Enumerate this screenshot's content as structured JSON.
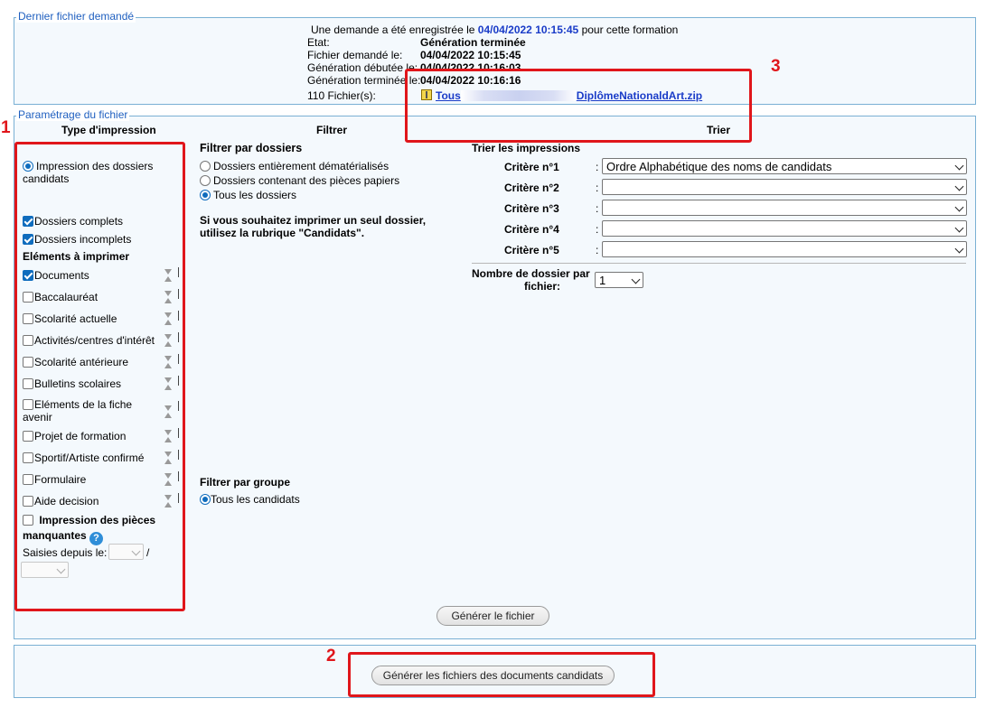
{
  "section_last_file": {
    "legend": "Dernier fichier demandé",
    "intro_prefix": "Une demande a été enregistrée le",
    "intro_date": "04/04/2022 10:15:45",
    "intro_suffix": "pour cette formation",
    "rows": [
      {
        "label": "Etat:",
        "value": "Génération terminée"
      },
      {
        "label": "Fichier demandé le:",
        "value": "04/04/2022 10:15:45"
      },
      {
        "label": "Génération débutée le:",
        "value": "04/04/2022 10:16:03"
      },
      {
        "label": "Génération terminée le:",
        "value": "04/04/2022 10:16:16"
      }
    ],
    "files_label": "110 Fichier(s):",
    "file_link_prefix": "Tous",
    "file_link_name": "DiplômeNationaldArt.zip"
  },
  "section_params": {
    "legend": "Paramétrage du fichier",
    "col_type": "Type d'impression",
    "col_filter": "Filtrer",
    "col_sort": "Trier"
  },
  "type_panel": {
    "radio_label": "Impression des dossiers candidats",
    "complete": "Dossiers complets",
    "incomplete": "Dossiers incomplets",
    "elements_heading": "Eléments à imprimer",
    "items": [
      {
        "label": "Documents",
        "checked": true
      },
      {
        "label": "Baccalauréat",
        "checked": false
      },
      {
        "label": "Scolarité actuelle",
        "checked": false
      },
      {
        "label": "Activités/centres d'intérêt",
        "checked": false
      },
      {
        "label": "Scolarité antérieure",
        "checked": false
      },
      {
        "label": "Bulletins scolaires",
        "checked": false
      },
      {
        "label": "Eléments de la fiche avenir",
        "checked": false
      },
      {
        "label": "Projet de formation",
        "checked": false
      },
      {
        "label": "Sportif/Artiste confirmé",
        "checked": false
      },
      {
        "label": "Formulaire",
        "checked": false
      },
      {
        "label": "Aide decision",
        "checked": false
      }
    ],
    "missing_line1": "Impression des pièces",
    "missing_line2": "manquantes",
    "since_label": "Saisies depuis le:",
    "slash": "/"
  },
  "filter_panel": {
    "folders_heading": "Filtrer par dossiers",
    "options": [
      {
        "label": "Dossiers entièrement dématérialisés",
        "selected": false
      },
      {
        "label": "Dossiers contenant des pièces papiers",
        "selected": false
      },
      {
        "label": "Tous les dossiers",
        "selected": true
      }
    ],
    "note_line1": "Si vous souhaitez imprimer un seul dossier,",
    "note_line2": "utilisez la rubrique \"Candidats\".",
    "group_heading": "Filtrer par groupe",
    "group_option": "Tous les candidats"
  },
  "sort_panel": {
    "heading": "Trier les impressions",
    "criteria": [
      {
        "label": "Critère n°1",
        "value": "Ordre Alphabétique des noms de candidats"
      },
      {
        "label": "Critère n°2",
        "value": ""
      },
      {
        "label": "Critère n°3",
        "value": ""
      },
      {
        "label": "Critère n°4",
        "value": ""
      },
      {
        "label": "Critère n°5",
        "value": ""
      }
    ],
    "colon": ":",
    "per_file_line1": "Nombre de dossier par",
    "per_file_line2": "fichier:",
    "per_file_value": "1"
  },
  "buttons": {
    "generate": "Générer le fichier",
    "generate_docs": "Générer les fichiers des documents candidats"
  },
  "annotations": {
    "n1": "1",
    "n2": "2",
    "n3": "3"
  },
  "colors": {
    "legend": "#2060c0",
    "border": "#7ab0d4",
    "panel_bg": "#f4f9fd",
    "accent": "#0f6cbd",
    "annotation": "#e0161b",
    "link": "#1a3cc8"
  }
}
